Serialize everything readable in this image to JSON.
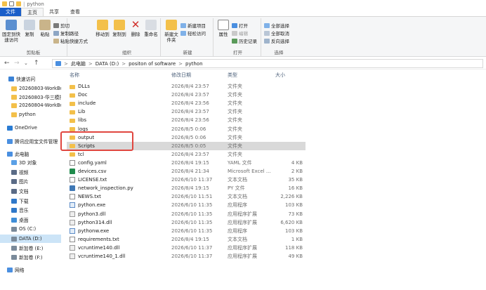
{
  "window": {
    "title": "python"
  },
  "tabs": [
    {
      "label": "文件"
    },
    {
      "label": "主页"
    },
    {
      "label": "共享"
    },
    {
      "label": "查看"
    }
  ],
  "ribbon": {
    "clipboard": {
      "label": "剪贴板",
      "pin": "固定到快速访问",
      "copy": "复制",
      "paste": "粘贴",
      "cut": "剪切",
      "copy_path": "复制路径",
      "paste_shortcut": "粘贴快捷方式"
    },
    "organize": {
      "label": "组织",
      "move_to": "移动到",
      "copy_to": "复制到",
      "delete": "删除",
      "rename": "重命名"
    },
    "new": {
      "label": "新建",
      "new_folder": "新建文件夹",
      "new_item": "新建项目",
      "easy_access": "轻松访问"
    },
    "open": {
      "label": "打开",
      "properties": "属性",
      "open": "打开",
      "edit": "编辑",
      "history": "历史记录"
    },
    "select": {
      "label": "选择",
      "select_all": "全部选择",
      "select_none": "全部取消",
      "invert": "反向选择"
    }
  },
  "address": {
    "crumbs": [
      "此电脑",
      "DATA (D:)",
      "positon of software",
      "python"
    ],
    "sep": ">"
  },
  "nav": {
    "items": [
      {
        "label": "快速访问",
        "color": "#3b82d6"
      },
      {
        "label": "20260803-WorkBu",
        "color": "#f3c04a"
      },
      {
        "label": "20260803-华三模拟",
        "color": "#f3c04a"
      },
      {
        "label": "20260804-WorkBu",
        "color": "#f3c04a"
      },
      {
        "label": "python",
        "color": "#f3c04a"
      },
      {
        "label": "OneDrive",
        "color": "#2b7cd3"
      },
      {
        "label": "腾讯应用宝文件管理",
        "color": "#4a8fe0"
      },
      {
        "label": "此电脑",
        "color": "#4a8fe0"
      },
      {
        "label": "3D 对象",
        "color": "#5aa0e6"
      },
      {
        "label": "视频",
        "color": "#5a6b86"
      },
      {
        "label": "图片",
        "color": "#5a6b86"
      },
      {
        "label": "文档",
        "color": "#5a6b86"
      },
      {
        "label": "下载",
        "color": "#2f78c9"
      },
      {
        "label": "音乐",
        "color": "#2f78c9"
      },
      {
        "label": "桌面",
        "color": "#3f8ed8"
      },
      {
        "label": "OS (C:)",
        "color": "#7a8a9a"
      },
      {
        "label": "DATA (D:)",
        "color": "#7a8a9a"
      },
      {
        "label": "新加卷 (E:)",
        "color": "#7a8a9a"
      },
      {
        "label": "新加卷 (F:)",
        "color": "#7a8a9a"
      },
      {
        "label": "网络",
        "color": "#4a8fe0"
      }
    ]
  },
  "list": {
    "headers": {
      "name": "名称",
      "date": "修改日期",
      "type": "类型",
      "size": "大小"
    },
    "rows": [
      {
        "name": "DLLs",
        "date": "2026/8/4 23:57",
        "type": "文件夹",
        "size": "",
        "icon": "folder"
      },
      {
        "name": "Doc",
        "date": "2026/8/4 23:57",
        "type": "文件夹",
        "size": "",
        "icon": "folder"
      },
      {
        "name": "include",
        "date": "2026/8/4 23:56",
        "type": "文件夹",
        "size": "",
        "icon": "folder"
      },
      {
        "name": "Lib",
        "date": "2026/8/4 23:57",
        "type": "文件夹",
        "size": "",
        "icon": "folder"
      },
      {
        "name": "libs",
        "date": "2026/8/4 23:56",
        "type": "文件夹",
        "size": "",
        "icon": "folder"
      },
      {
        "name": "logs",
        "date": "2026/8/5 0:06",
        "type": "文件夹",
        "size": "",
        "icon": "folder"
      },
      {
        "name": "output",
        "date": "2026/8/5 0:06",
        "type": "文件夹",
        "size": "",
        "icon": "folder"
      },
      {
        "name": "Scripts",
        "date": "2026/8/5 0:05",
        "type": "文件夹",
        "size": "",
        "icon": "folder",
        "selected": true
      },
      {
        "name": "tcl",
        "date": "2026/8/4 23:57",
        "type": "文件夹",
        "size": "",
        "icon": "folder"
      },
      {
        "name": "config.yaml",
        "date": "2026/8/4 19:15",
        "type": "YAML 文件",
        "size": "4 KB",
        "icon": "doc"
      },
      {
        "name": "devices.csv",
        "date": "2026/8/4 21:34",
        "type": "Microsoft Excel ...",
        "size": "2 KB",
        "icon": "csv"
      },
      {
        "name": "LICENSE.txt",
        "date": "2026/6/10 11:37",
        "type": "文本文档",
        "size": "35 KB",
        "icon": "doc"
      },
      {
        "name": "network_inspection.py",
        "date": "2026/8/4 19:15",
        "type": "PY 文件",
        "size": "16 KB",
        "icon": "py"
      },
      {
        "name": "NEWS.txt",
        "date": "2026/6/10 11:51",
        "type": "文本文档",
        "size": "2,226 KB",
        "icon": "doc"
      },
      {
        "name": "python.exe",
        "date": "2026/6/10 11:35",
        "type": "应用程序",
        "size": "103 KB",
        "icon": "exe"
      },
      {
        "name": "python3.dll",
        "date": "2026/6/10 11:35",
        "type": "应用程序扩展",
        "size": "73 KB",
        "icon": "dll"
      },
      {
        "name": "python314.dll",
        "date": "2026/6/10 11:35",
        "type": "应用程序扩展",
        "size": "6,620 KB",
        "icon": "dll"
      },
      {
        "name": "pythonw.exe",
        "date": "2026/6/10 11:35",
        "type": "应用程序",
        "size": "103 KB",
        "icon": "exe"
      },
      {
        "name": "requirements.txt",
        "date": "2026/8/4 19:15",
        "type": "文本文档",
        "size": "1 KB",
        "icon": "doc"
      },
      {
        "name": "vcruntime140.dll",
        "date": "2026/6/10 11:37",
        "type": "应用程序扩展",
        "size": "118 KB",
        "icon": "dll"
      },
      {
        "name": "vcruntime140_1.dll",
        "date": "2026/6/10 11:37",
        "type": "应用程序扩展",
        "size": "49 KB",
        "icon": "dll"
      }
    ]
  },
  "colors": {
    "accent": "#1a5ec9",
    "highlight": "#e0463f",
    "folder": "#f3c04a"
  }
}
